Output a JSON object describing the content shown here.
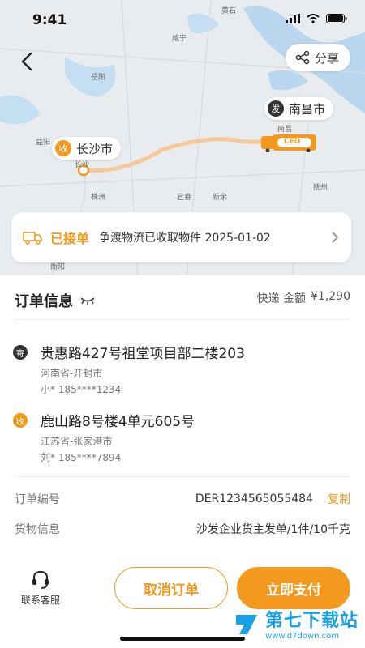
{
  "status_bar": {
    "time": "9:41"
  },
  "map": {
    "share_label": "分享",
    "origin": {
      "badge": "收",
      "city": "长沙市"
    },
    "destination": {
      "badge": "发",
      "city": "南昌市"
    },
    "labels": [
      "黄石",
      "咸宁",
      "岳阳",
      "益阳",
      "长沙",
      "株洲",
      "宜春",
      "新余",
      "抚州",
      "南昌",
      "衡阳"
    ],
    "truck_plate": "CED"
  },
  "status_card": {
    "status": "已接单",
    "message": "争渡物流已收取物件 2025-01-02"
  },
  "order": {
    "title": "订单信息",
    "amount_prefix": "快递 金额",
    "amount": "¥1,290",
    "sender": {
      "badge": "寄",
      "address": "贵惠路427号祖堂项目部二楼203",
      "region": "河南省-开封市",
      "contact": "小*   185****1234"
    },
    "receiver": {
      "badge": "收",
      "address": "鹿山路8号楼4单元605号",
      "region": "江苏省-张家港市",
      "contact": "刘*   185****7894"
    },
    "order_no_label": "订单编号",
    "order_no": "DER1234565055484",
    "copy_label": "复制",
    "goods_label": "货物信息",
    "goods": "沙发企业货主发单/1件/10千克"
  },
  "bottom_bar": {
    "service_label": "联系客服",
    "cancel_label": "取消订单",
    "pay_label": "立即支付"
  },
  "watermark": {
    "title": "第七下载站",
    "url": "www.d7down.com"
  },
  "colors": {
    "accent": "#f39a1e",
    "dark_badge": "#333333"
  }
}
